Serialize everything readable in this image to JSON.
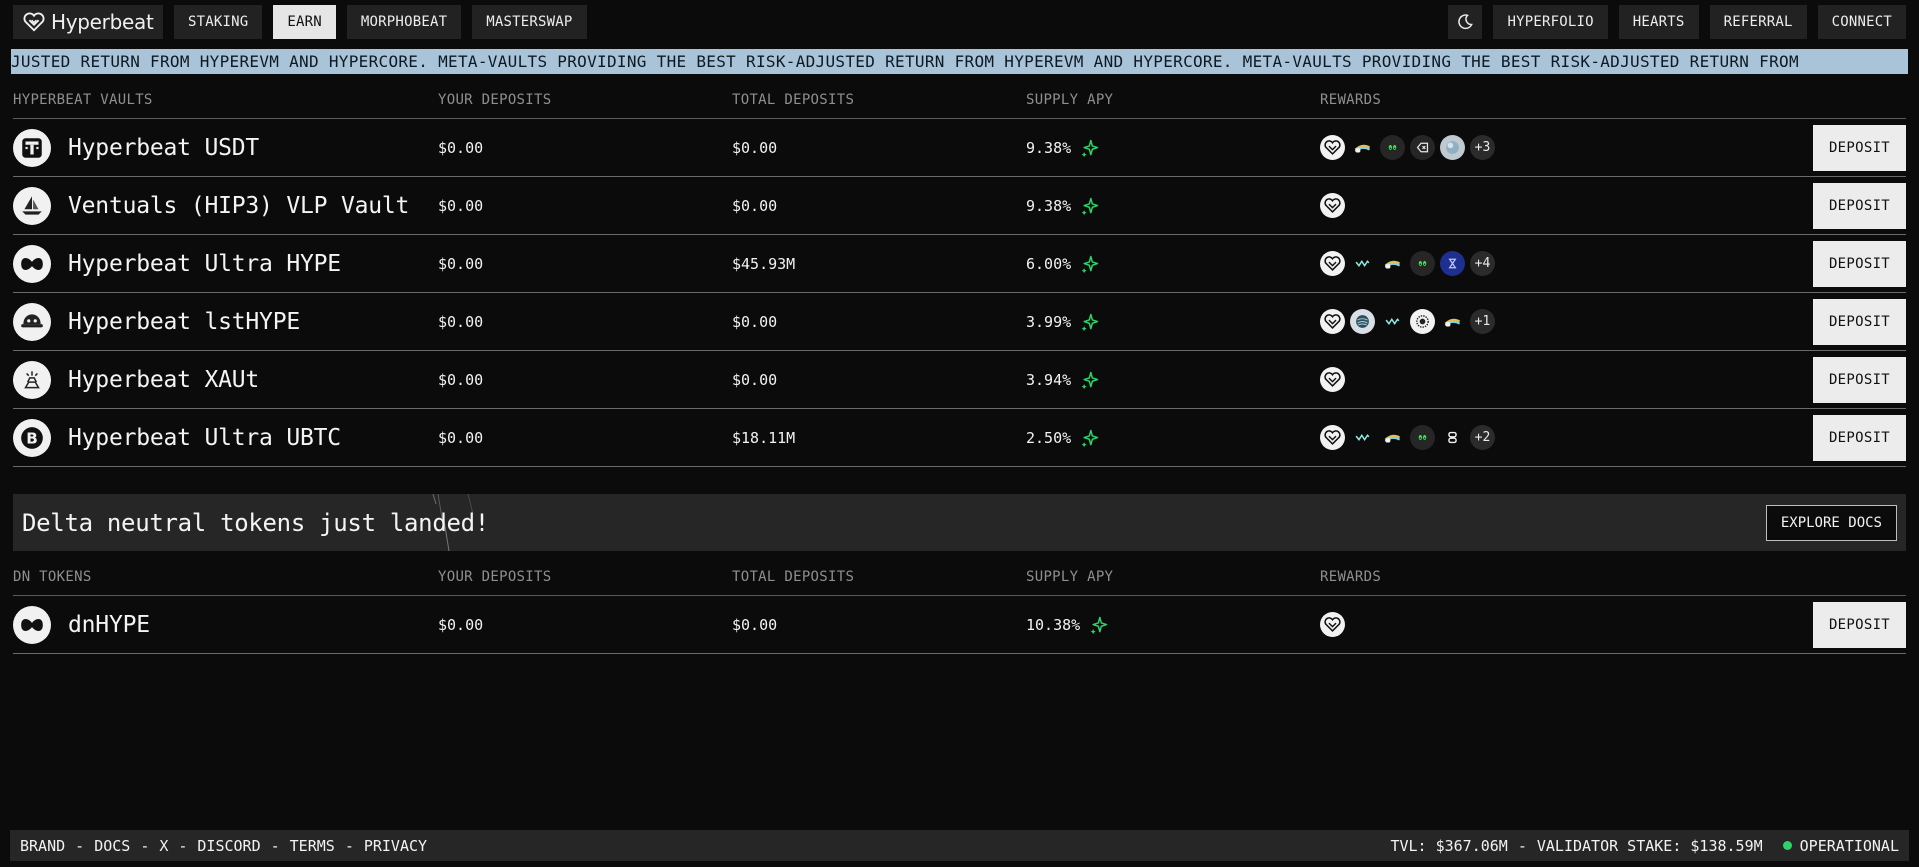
{
  "nav": {
    "logo_text": "Hyperbeat",
    "left_items": [
      "STAKING",
      "EARN",
      "MORPHOBEAT",
      "MASTERSWAP"
    ],
    "active_item": "EARN",
    "right_items": [
      "HYPERFOLIO",
      "HEARTS",
      "REFERRAL",
      "CONNECT"
    ]
  },
  "ticker": {
    "text": "JUSTED RETURN FROM HYPEREVM AND HYPERCORE. META-VAULTS PROVIDING THE BEST RISK-ADJUSTED RETURN FROM HYPEREVM AND HYPERCORE. META-VAULTS PROVIDING THE BEST RISK-ADJUSTED RETURN FROM"
  },
  "vaults_table": {
    "headers": [
      "HYPERBEAT VAULTS",
      "YOUR DEPOSITS",
      "TOTAL DEPOSITS",
      "SUPPLY APY",
      "REWARDS"
    ],
    "deposit_label": "DEPOSIT",
    "rows": [
      {
        "name": "Hyperbeat USDT",
        "icon": "usdt-vault-icon",
        "your_deposits": "$0.00",
        "total_deposits": "$0.00",
        "apy": "9.38%",
        "rewards": [
          "hyperbeat-reward-icon",
          "rainbow-reward-icon",
          "eyes-reward-icon",
          "tag-reward-icon",
          "planet-reward-icon"
        ],
        "more": "+3"
      },
      {
        "name": "Ventuals (HIP3) VLP Vault",
        "icon": "ship-vault-icon",
        "your_deposits": "$0.00",
        "total_deposits": "$0.00",
        "apy": "9.38%",
        "rewards": [
          "hyperbeat-reward-icon"
        ],
        "more": ""
      },
      {
        "name": "Hyperbeat Ultra HYPE",
        "icon": "hype-vault-icon",
        "your_deposits": "$0.00",
        "total_deposits": "$45.93M",
        "apy": "6.00%",
        "rewards": [
          "hyperbeat-reward-icon",
          "wave-reward-icon",
          "rainbow-reward-icon",
          "eyes-reward-icon",
          "hourglass-reward-icon"
        ],
        "more": "+4"
      },
      {
        "name": "Hyperbeat lstHYPE",
        "icon": "hat-vault-icon",
        "your_deposits": "$0.00",
        "total_deposits": "$0.00",
        "apy": "3.99%",
        "rewards": [
          "hyperbeat-reward-icon",
          "swirl-reward-icon",
          "wave-reward-icon",
          "lion-reward-icon",
          "rainbow-reward-icon"
        ],
        "more": "+1"
      },
      {
        "name": "Hyperbeat XAUt",
        "icon": "gold-vault-icon",
        "your_deposits": "$0.00",
        "total_deposits": "$0.00",
        "apy": "3.94%",
        "rewards": [
          "hyperbeat-reward-icon"
        ],
        "more": ""
      },
      {
        "name": "Hyperbeat Ultra UBTC",
        "icon": "bitcoin-vault-icon",
        "your_deposits": "$0.00",
        "total_deposits": "$18.11M",
        "apy": "2.50%",
        "rewards": [
          "hyperbeat-reward-icon",
          "wave-reward-icon",
          "rainbow-reward-icon",
          "eyes-reward-icon",
          "chain-reward-icon"
        ],
        "more": "+2"
      }
    ]
  },
  "banner": {
    "title": "Delta neutral tokens just landed!",
    "button": "EXPLORE DOCS"
  },
  "dn_table": {
    "headers": [
      "DN TOKENS",
      "YOUR DEPOSITS",
      "TOTAL DEPOSITS",
      "SUPPLY APY",
      "REWARDS"
    ],
    "deposit_label": "DEPOSIT",
    "rows": [
      {
        "name": "dnHYPE",
        "icon": "hype-vault-icon",
        "your_deposits": "$0.00",
        "total_deposits": "$0.00",
        "apy": "10.38%",
        "rewards": [
          "hyperbeat-reward-icon"
        ],
        "more": ""
      }
    ]
  },
  "footer": {
    "links": [
      "BRAND",
      "DOCS",
      "X",
      "DISCORD",
      "TERMS",
      "PRIVACY"
    ],
    "separator": "-",
    "tvl": "TVL: $367.06M",
    "validator_stake": "VALIDATOR STAKE: $138.59M",
    "status": "OPERATIONAL",
    "status_color": "#2fd26a"
  },
  "colors": {
    "background": "#0b0b0b",
    "ticker_bg": "#a9c4d8",
    "accent_green": "#2fd26a",
    "active_tab_bg": "#e6e6e6"
  }
}
